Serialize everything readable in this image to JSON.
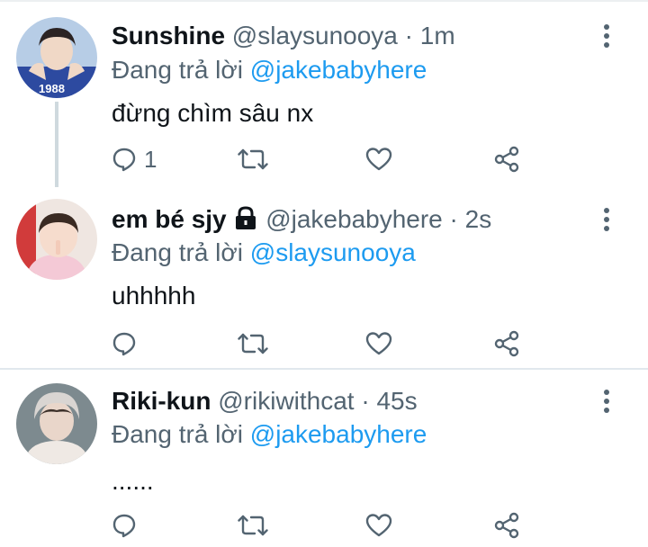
{
  "colors": {
    "accent": "#1d9bf0",
    "text": "#0f1419",
    "muted": "#536471"
  },
  "tweets": [
    {
      "name": "Sunshine",
      "handle": "@slaysunooya",
      "separator": "·",
      "time": "1m",
      "reply_prefix": "Đang trả lời",
      "reply_to": "@jakebabyhere",
      "text": "đừng chìm sâu nx",
      "reply_count": "1",
      "avatar_text": "1988"
    },
    {
      "name": "em bé sjy",
      "handle": "@jakebabyhere",
      "separator": "·",
      "time": "2s",
      "reply_prefix": "Đang trả lời",
      "reply_to": "@slaysunooya",
      "text": "uhhhhh",
      "reply_count": ""
    },
    {
      "name": "Riki-kun",
      "handle": "@rikiwithcat",
      "separator": "·",
      "time": "45s",
      "reply_prefix": "Đang trả lời",
      "reply_to": "@jakebabyhere",
      "text": "......",
      "reply_count": ""
    }
  ],
  "icons": {
    "more": "more-vertical-icon",
    "reply": "reply-bubble-icon",
    "retweet": "retweet-icon",
    "like": "heart-icon",
    "share": "share-icon",
    "protected": "lock-icon"
  }
}
